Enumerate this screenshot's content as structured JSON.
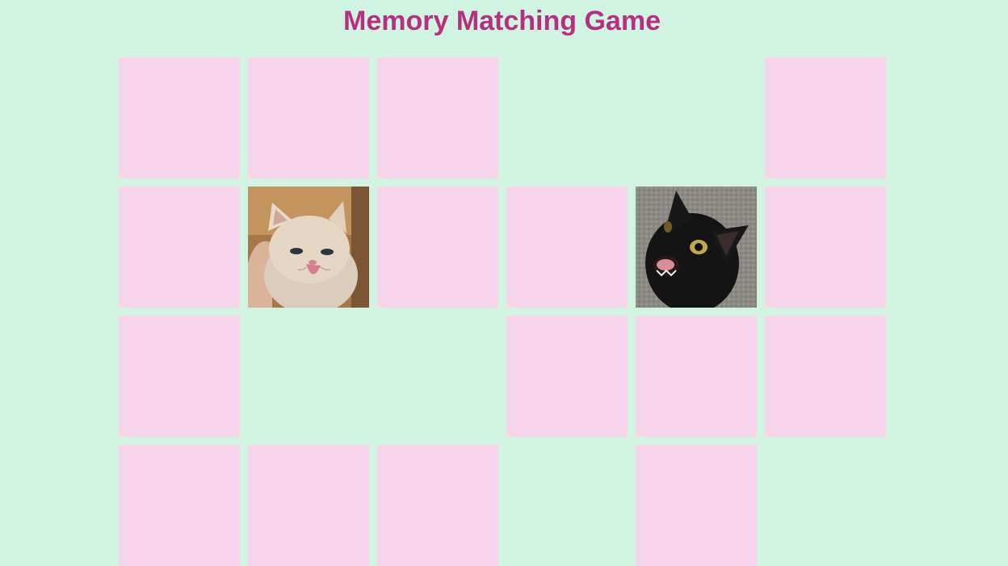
{
  "title": "Memory Matching Game",
  "colors": {
    "background": "#d1f4e2",
    "title": "#b5307f",
    "card_back": "#f8d5ea"
  },
  "grid": {
    "columns": 6,
    "rows": 4
  },
  "cards": [
    {
      "state": "hidden"
    },
    {
      "state": "hidden"
    },
    {
      "state": "hidden"
    },
    {
      "state": "matched"
    },
    {
      "state": "matched"
    },
    {
      "state": "hidden"
    },
    {
      "state": "hidden"
    },
    {
      "state": "revealed",
      "image": "cream-persian-kitten"
    },
    {
      "state": "hidden"
    },
    {
      "state": "hidden"
    },
    {
      "state": "revealed",
      "image": "black-cat"
    },
    {
      "state": "hidden"
    },
    {
      "state": "hidden"
    },
    {
      "state": "matched"
    },
    {
      "state": "matched"
    },
    {
      "state": "hidden"
    },
    {
      "state": "hidden"
    },
    {
      "state": "hidden"
    },
    {
      "state": "hidden"
    },
    {
      "state": "hidden"
    },
    {
      "state": "hidden"
    },
    {
      "state": "matched"
    },
    {
      "state": "hidden"
    },
    {
      "state": "matched"
    }
  ]
}
